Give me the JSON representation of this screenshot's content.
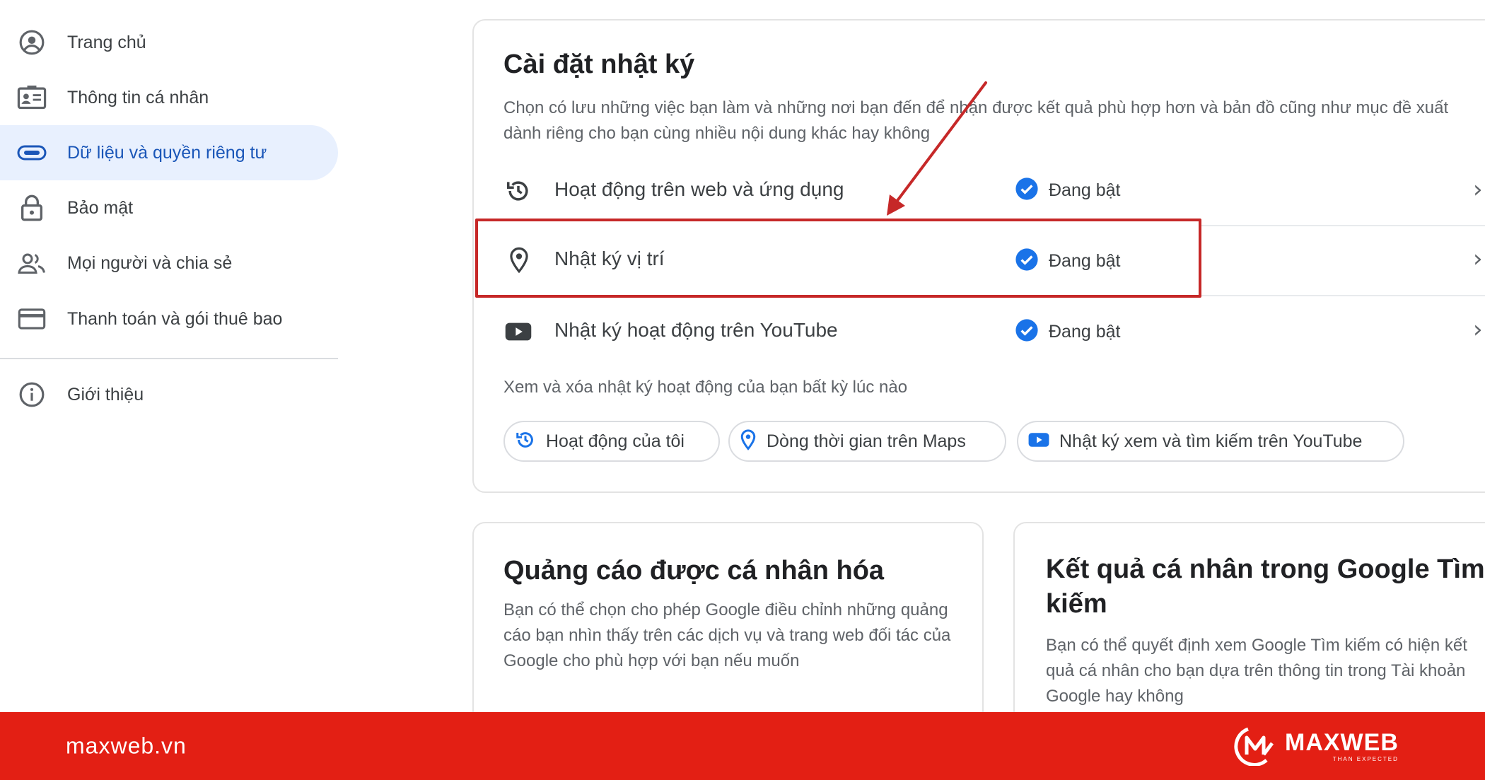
{
  "sidebar": {
    "items": [
      {
        "label": "Trang chủ",
        "icon": "account-circle-icon"
      },
      {
        "label": "Thông tin cá nhân",
        "icon": "id-card-icon"
      },
      {
        "label": "Dữ liệu và quyền riêng tư",
        "icon": "toggle-icon",
        "active": true
      },
      {
        "label": "Bảo mật",
        "icon": "lock-icon"
      },
      {
        "label": "Mọi người và chia sẻ",
        "icon": "people-icon"
      },
      {
        "label": "Thanh toán và gói thuê bao",
        "icon": "credit-card-icon"
      },
      {
        "label": "Giới thiệu",
        "icon": "info-icon"
      }
    ]
  },
  "history_card": {
    "title": "Cài đặt nhật ký",
    "description": "Chọn có lưu những việc bạn làm và những nơi bạn đến để nhận được kết quả phù hợp hơn và bản đồ cũng như mục đề xuất dành riêng cho bạn cùng nhiều nội dung khác hay không",
    "rows": [
      {
        "label": "Hoạt động trên web và ứng dụng",
        "status": "Đang bật",
        "icon": "history-icon"
      },
      {
        "label": "Nhật ký vị trí",
        "status": "Đang bật",
        "icon": "location-pin-icon"
      },
      {
        "label": "Nhật ký hoạt động trên YouTube",
        "status": "Đang bật",
        "icon": "youtube-icon"
      }
    ],
    "view_text": "Xem và xóa nhật ký hoạt động của bạn bất kỳ lúc nào",
    "links": [
      {
        "label": "Hoạt động của tôi",
        "icon": "history-icon"
      },
      {
        "label": "Dòng thời gian trên Maps",
        "icon": "location-pin-icon"
      },
      {
        "label": "Nhật ký xem và tìm kiếm trên YouTube",
        "icon": "youtube-icon"
      }
    ]
  },
  "ads_card": {
    "title": "Quảng cáo được cá nhân hóa",
    "description": "Bạn có thể chọn cho phép Google điều chỉnh những quảng cáo bạn nhìn thấy trên các dịch vụ và trang web đối tác của Google cho phù hợp với bạn nếu muốn"
  },
  "search_card": {
    "title_line1": "Kết quả cá nhân trong Google Tìm",
    "title_line2": "kiếm",
    "description": "Bạn có thể quyết định xem Google Tìm kiếm có hiện kết quả cá nhân cho bạn dựa trên thông tin trong Tài khoản Google hay không"
  },
  "footer": {
    "site": "maxweb.vn",
    "brand_name": "MAXWEB",
    "brand_tagline": "THAN EXPECTED"
  },
  "colors": {
    "accent_blue": "#1a73e8",
    "active_bg": "#e8f0fe",
    "highlight_red": "#c62828",
    "footer_red": "#e31f14"
  }
}
